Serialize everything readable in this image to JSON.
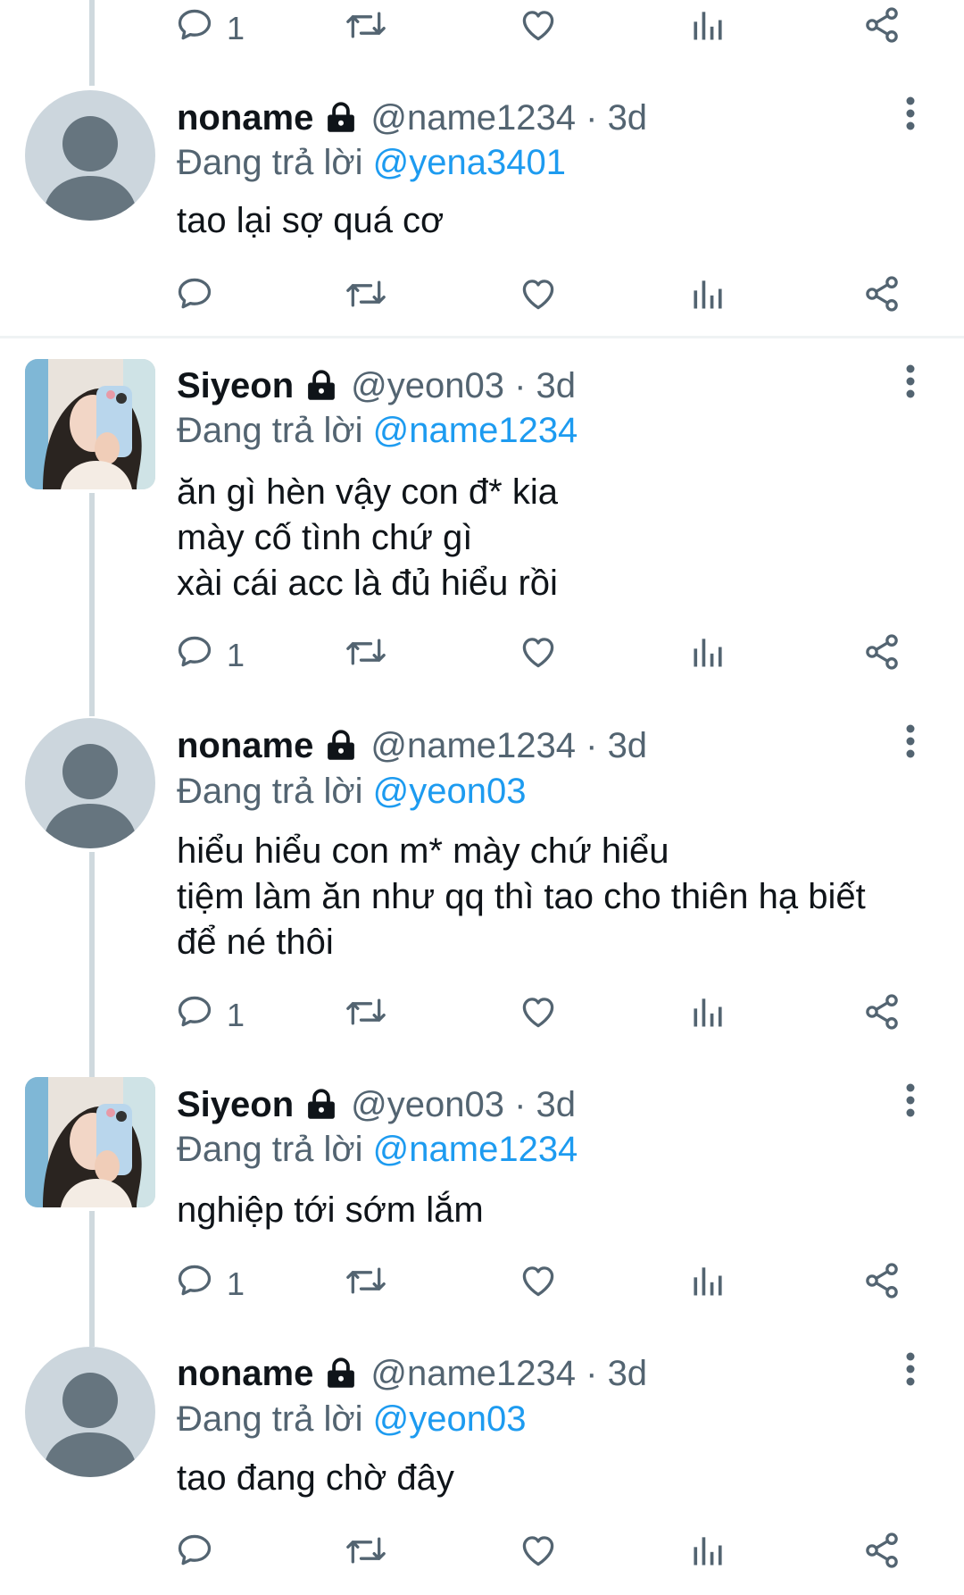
{
  "top_actions": {
    "reply_count": "1"
  },
  "tweets": [
    {
      "name": "noname",
      "handle": "@name1234",
      "sep": " · ",
      "time": "3d",
      "replying_prefix": "Đang trả lời ",
      "replying_to": "@yena3401",
      "lines": [
        "tao lại sợ quá cơ"
      ],
      "reply_count": "",
      "avatar": "default-avatar"
    },
    {
      "name": "Siyeon",
      "handle": "@yeon03",
      "sep": " · ",
      "time": "3d",
      "replying_prefix": "Đang trả lời ",
      "replying_to": "@name1234",
      "lines": [
        "ăn gì hèn vậy con đ* kia",
        "mày cố tình chứ gì",
        "xài cái acc là đủ hiểu rồi"
      ],
      "reply_count": "1",
      "avatar": "profile-photo"
    },
    {
      "name": "noname",
      "handle": "@name1234",
      "sep": " · ",
      "time": "3d",
      "replying_prefix": "Đang trả lời ",
      "replying_to": "@yeon03",
      "lines": [
        "hiểu hiểu con m* mày chứ hiểu",
        "tiệm làm ăn như qq thì tao cho thiên hạ biết",
        "để né thôi"
      ],
      "reply_count": "1",
      "avatar": "default-avatar"
    },
    {
      "name": "Siyeon",
      "handle": "@yeon03",
      "sep": " · ",
      "time": "3d",
      "replying_prefix": "Đang trả lời ",
      "replying_to": "@name1234",
      "lines": [
        "nghiệp tới sớm lắm"
      ],
      "reply_count": "1",
      "avatar": "profile-photo"
    },
    {
      "name": "noname",
      "handle": "@name1234",
      "sep": " · ",
      "time": "3d",
      "replying_prefix": "Đang trả lời ",
      "replying_to": "@yeon03",
      "lines": [
        "tao đang chờ đây"
      ],
      "reply_count": "",
      "avatar": "default-avatar"
    }
  ],
  "colors": {
    "link": "#1d9bf0",
    "secondary": "#536471",
    "thread_line": "#cfd9de"
  }
}
